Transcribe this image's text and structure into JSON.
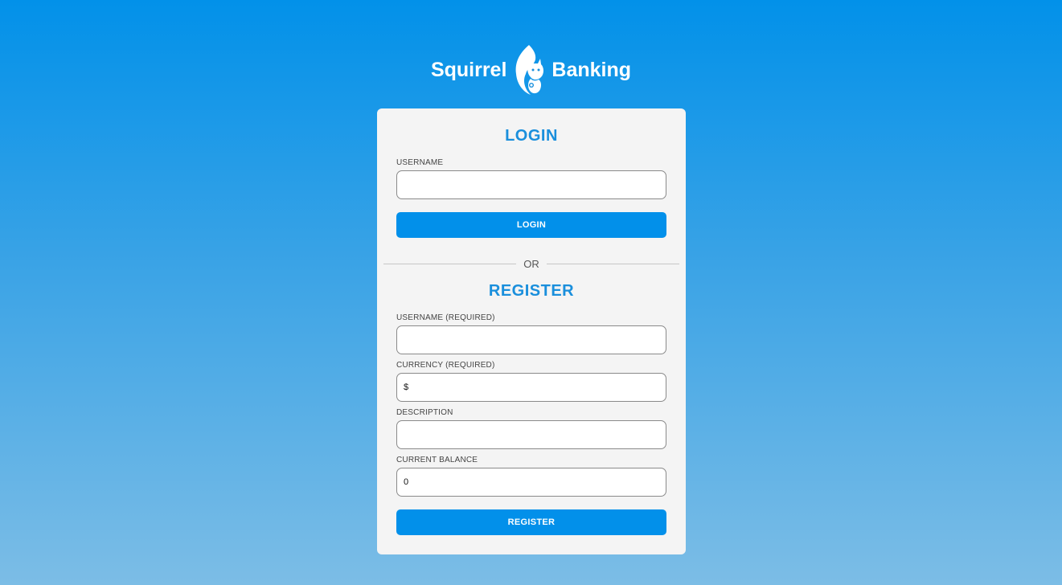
{
  "brand": {
    "left_word": "Squirrel",
    "right_word": "Banking",
    "logo_icon": "squirrel-logo-icon"
  },
  "login": {
    "title": "LOGIN",
    "username_label": "USERNAME",
    "username_value": "",
    "button_label": "LOGIN"
  },
  "divider": {
    "text": "OR"
  },
  "register": {
    "title": "REGISTER",
    "username_label": "USERNAME (REQUIRED)",
    "username_value": "",
    "currency_label": "CURRENCY (REQUIRED)",
    "currency_value": "$",
    "description_label": "DESCRIPTION",
    "description_value": "",
    "balance_label": "CURRENT BALANCE",
    "balance_value": "0",
    "button_label": "REGISTER"
  },
  "colors": {
    "accent": "#0290ea",
    "heading": "#1a8fdc",
    "card_bg": "#f4f4f4"
  }
}
